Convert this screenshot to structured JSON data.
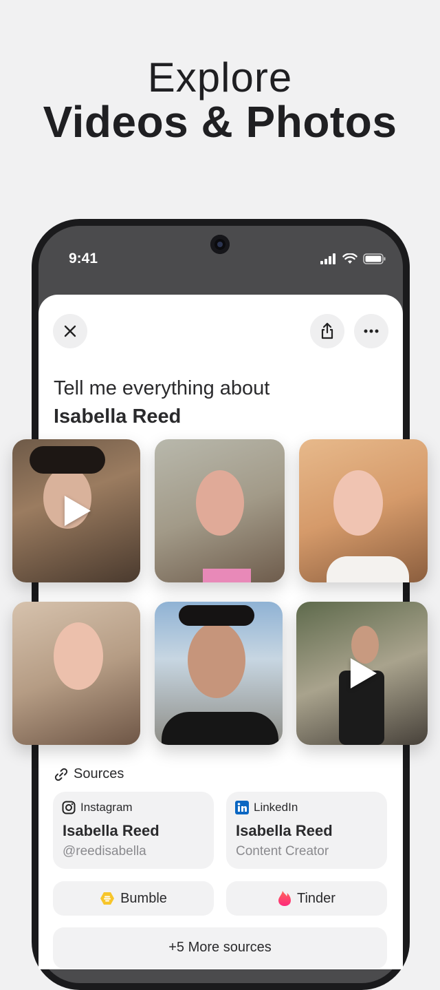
{
  "hero": {
    "line1": "Explore",
    "line2": "Videos & Photos"
  },
  "status_bar": {
    "time": "9:41"
  },
  "header": {
    "prompt": "Tell me everything about",
    "person": "Isabella Reed"
  },
  "icons": {
    "close": "close-icon",
    "share": "share-icon",
    "more": "more-icon",
    "link": "link-icon"
  },
  "media": [
    {
      "type": "video"
    },
    {
      "type": "photo"
    },
    {
      "type": "photo"
    },
    {
      "type": "photo"
    },
    {
      "type": "photo"
    },
    {
      "type": "video"
    }
  ],
  "sources": {
    "label": "Sources",
    "cards": [
      {
        "platform": "Instagram",
        "name": "Isabella Reed",
        "subtitle": "@reedisabella"
      },
      {
        "platform": "LinkedIn",
        "name": "Isabella Reed",
        "subtitle": "Content Creator"
      }
    ],
    "pills": [
      {
        "label": "Bumble"
      },
      {
        "label": "Tinder"
      }
    ],
    "more": "+5 More sources"
  },
  "colors": {
    "linkedin": "#0A66C2",
    "bumble": "#F7C52A",
    "tinder": "#FE3C72"
  }
}
